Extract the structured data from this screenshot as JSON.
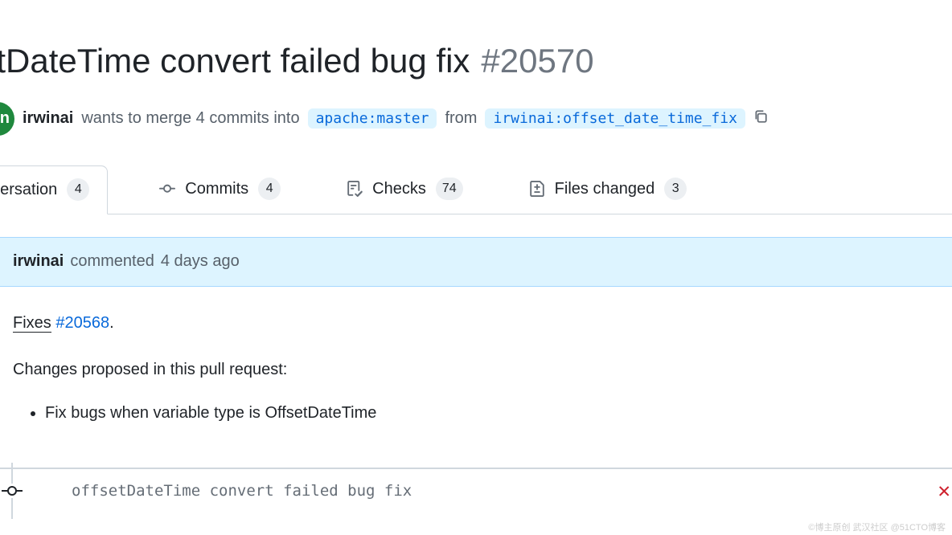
{
  "pr": {
    "title": "etDateTime convert failed bug fix",
    "number": "#20570",
    "state_letter": "n",
    "author": "irwinai",
    "merge_text_1": "wants to merge 4 commits into",
    "base_branch": "apache:master",
    "merge_text_2": "from",
    "head_branch": "irwinai:offset_date_time_fix"
  },
  "tabs": {
    "conversation": {
      "label": "nversation",
      "count": "4"
    },
    "commits": {
      "label": "Commits",
      "count": "4"
    },
    "checks": {
      "label": "Checks",
      "count": "74"
    },
    "files": {
      "label": "Files changed",
      "count": "3"
    }
  },
  "comment": {
    "author": "irwinai",
    "action": "commented",
    "time": "4 days ago",
    "fixes_label": "Fixes",
    "fixes_link": "#20568",
    "fixes_dot": ".",
    "changes_label": "Changes proposed in this pull request:",
    "bullet1": "Fix bugs when variable type is OffsetDateTime"
  },
  "timeline": {
    "commit_message": "offsetDateTime convert failed bug fix"
  },
  "watermark": "©博主原创 武汉社区 @51CTO博客"
}
